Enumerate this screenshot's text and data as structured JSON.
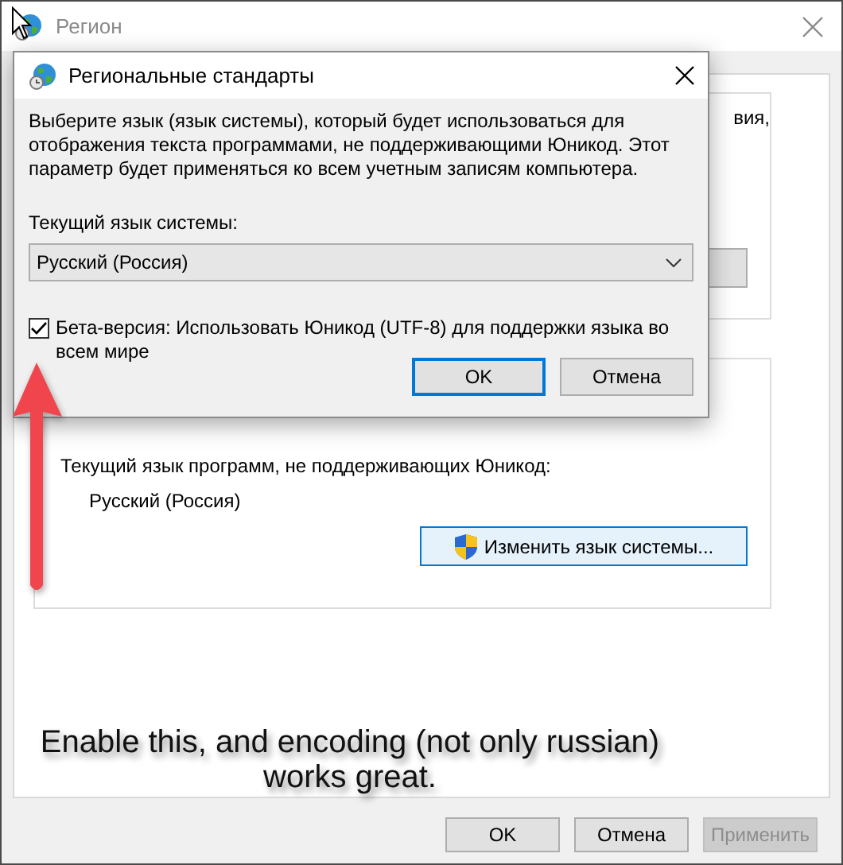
{
  "window": {
    "title": "Регион",
    "group_1": {
      "text": "вия,"
    },
    "group_2": {
      "label": "Текущий язык программ, не поддерживающих Юникод:",
      "value": "Русский (Россия)",
      "button": "Изменить язык системы..."
    },
    "buttons": [
      {
        "label": "OK",
        "disabled": false
      },
      {
        "label": "Отмена",
        "disabled": false
      },
      {
        "label": "Применить",
        "disabled": true
      }
    ]
  },
  "dialog": {
    "title": "Региональные стандарты",
    "description": "Выберите язык (язык системы), который будет использоваться для отображения текста программами, не поддерживающими Юникод. Этот параметр будет применяться ко всем учетным записям компьютера.",
    "system_language_label": "Текущий язык системы:",
    "system_language": {
      "value": "Русский (Россия)"
    },
    "beta_option": {
      "label": "Бета-версия: Использовать Юникод (UTF-8) для поддержки языка во всем мире",
      "checked": true
    },
    "buttons": [
      {
        "label": "OK",
        "default": true
      },
      {
        "label": "Отмена",
        "default": false
      }
    ]
  },
  "annotation": {
    "text": "Enable this, and encoding (not only russian)\nworks great."
  }
}
